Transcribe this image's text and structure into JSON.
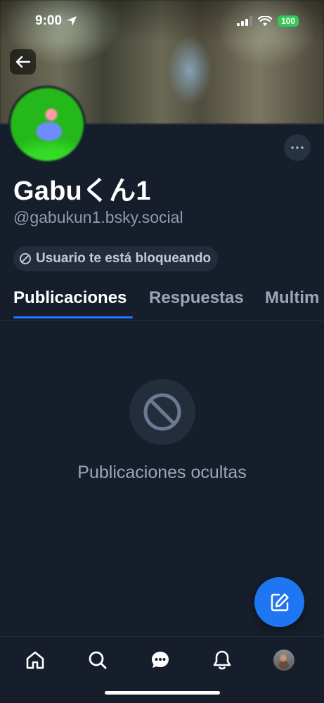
{
  "status_bar": {
    "time": "9:00",
    "battery": "100"
  },
  "profile": {
    "display_name": "Gabuくん1",
    "handle": "@gabukun1.bsky.social",
    "blocked_label": "Usuario te está bloqueando"
  },
  "tabs": [
    {
      "label": "Publicaciones",
      "active": true
    },
    {
      "label": "Respuestas",
      "active": false
    },
    {
      "label": "Multim",
      "active": false
    }
  ],
  "empty_state": {
    "text": "Publicaciones ocultas",
    "icon": "blocked-icon"
  },
  "bottom_nav": {
    "items": [
      "home-icon",
      "search-icon",
      "chat-icon",
      "bell-icon",
      "profile-avatar"
    ]
  },
  "colors": {
    "background": "#161e2b",
    "accent": "#1f76f2",
    "muted_text": "#9aa6b8"
  }
}
